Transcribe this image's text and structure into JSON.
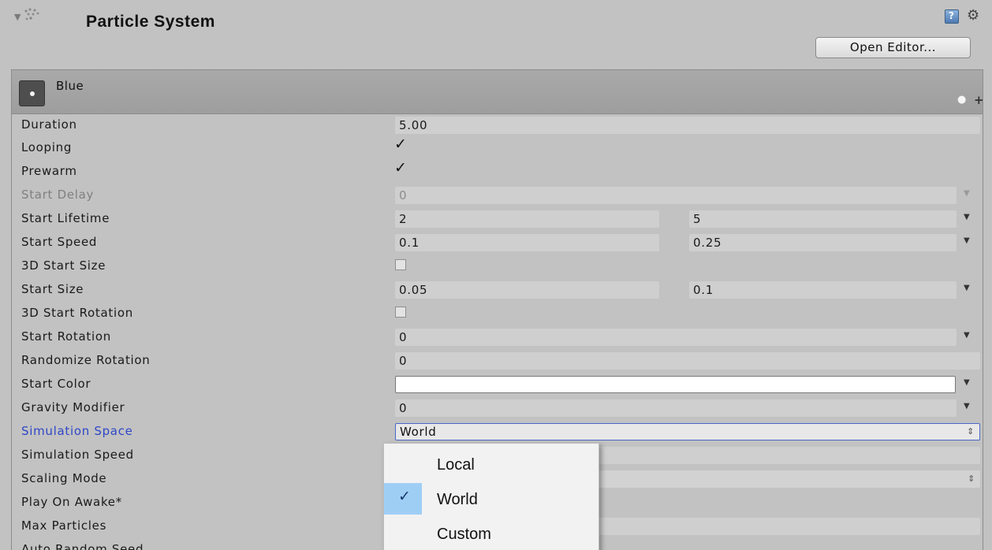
{
  "component": {
    "title": "Particle System",
    "open_editor_label": "Open Editor...",
    "icons": {
      "foldout": "foldout-arrow-icon",
      "component": "particle-system-icon",
      "help": "help-book-icon",
      "settings": "gear-icon"
    }
  },
  "system": {
    "name": "Blue",
    "icons": {
      "system": "particle-system-thumbnail-icon",
      "pin": "pin-icon",
      "add": "plus-icon"
    }
  },
  "properties": [
    {
      "label": "Duration",
      "value": "5.00"
    },
    {
      "label": "Looping",
      "checked": true
    },
    {
      "label": "Prewarm",
      "checked": true
    },
    {
      "label": "Start Delay",
      "value": "0"
    },
    {
      "label": "Start Lifetime",
      "min": "2",
      "max": "5"
    },
    {
      "label": "Start Speed",
      "min": "0.1",
      "max": "0.25"
    },
    {
      "label": "3D Start Size",
      "checked": false
    },
    {
      "label": "Start Size",
      "min": "0.05",
      "max": "0.1"
    },
    {
      "label": "3D Start Rotation",
      "checked": false
    },
    {
      "label": "Start Rotation",
      "value": "0"
    },
    {
      "label": "Randomize Rotation",
      "value": "0"
    },
    {
      "label": "Start Color",
      "value_color": "#ffffff"
    },
    {
      "label": "Gravity Modifier",
      "value": "0"
    },
    {
      "label": "Simulation Space",
      "value": "World"
    },
    {
      "label": "Simulation Speed"
    },
    {
      "label": "Scaling Mode"
    },
    {
      "label": "Play On Awake*"
    },
    {
      "label": "Max Particles"
    },
    {
      "label": "Auto Random Seed"
    }
  ],
  "simulation_space_dropdown": {
    "options": [
      "Local",
      "World",
      "Custom"
    ],
    "selected": "World"
  },
  "colors": {
    "highlight_label": "#2f47c7",
    "selected_option_bg": "#9fcef5"
  }
}
